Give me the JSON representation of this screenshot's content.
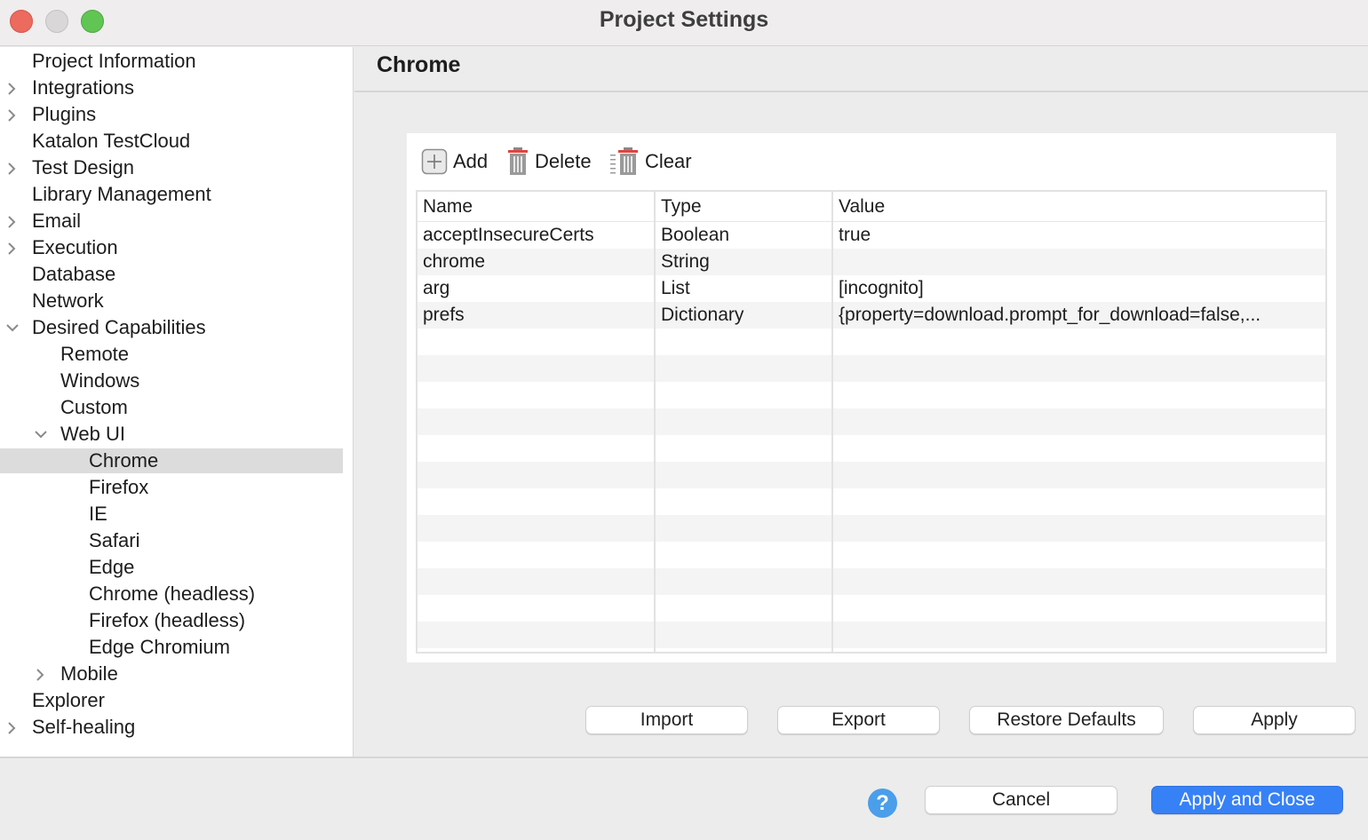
{
  "window": {
    "title": "Project Settings"
  },
  "sidebar": {
    "items": [
      {
        "label": "Project Information",
        "level": 0,
        "expander": "none",
        "selected": false
      },
      {
        "label": "Integrations",
        "level": 0,
        "expander": "collapsed",
        "selected": false
      },
      {
        "label": "Plugins",
        "level": 0,
        "expander": "collapsed",
        "selected": false
      },
      {
        "label": "Katalon TestCloud",
        "level": 0,
        "expander": "none",
        "selected": false
      },
      {
        "label": "Test Design",
        "level": 0,
        "expander": "collapsed",
        "selected": false
      },
      {
        "label": "Library Management",
        "level": 0,
        "expander": "none",
        "selected": false
      },
      {
        "label": "Email",
        "level": 0,
        "expander": "collapsed",
        "selected": false
      },
      {
        "label": "Execution",
        "level": 0,
        "expander": "collapsed",
        "selected": false
      },
      {
        "label": "Database",
        "level": 0,
        "expander": "none",
        "selected": false
      },
      {
        "label": "Network",
        "level": 0,
        "expander": "none",
        "selected": false
      },
      {
        "label": "Desired Capabilities",
        "level": 0,
        "expander": "expanded",
        "selected": false
      },
      {
        "label": "Remote",
        "level": 1,
        "expander": "none",
        "selected": false
      },
      {
        "label": "Windows",
        "level": 1,
        "expander": "none",
        "selected": false
      },
      {
        "label": "Custom",
        "level": 1,
        "expander": "none",
        "selected": false
      },
      {
        "label": "Web UI",
        "level": 1,
        "expander": "expanded",
        "selected": false
      },
      {
        "label": "Chrome",
        "level": 2,
        "expander": "none",
        "selected": true
      },
      {
        "label": "Firefox",
        "level": 2,
        "expander": "none",
        "selected": false
      },
      {
        "label": "IE",
        "level": 2,
        "expander": "none",
        "selected": false
      },
      {
        "label": "Safari",
        "level": 2,
        "expander": "none",
        "selected": false
      },
      {
        "label": "Edge",
        "level": 2,
        "expander": "none",
        "selected": false
      },
      {
        "label": "Chrome (headless)",
        "level": 2,
        "expander": "none",
        "selected": false
      },
      {
        "label": "Firefox (headless)",
        "level": 2,
        "expander": "none",
        "selected": false
      },
      {
        "label": "Edge Chromium",
        "level": 2,
        "expander": "none",
        "selected": false
      },
      {
        "label": "Mobile",
        "level": 1,
        "expander": "collapsed",
        "selected": false
      },
      {
        "label": "Explorer",
        "level": 0,
        "expander": "none",
        "selected": false
      },
      {
        "label": "Self-healing",
        "level": 0,
        "expander": "collapsed",
        "selected": false
      }
    ]
  },
  "main": {
    "title": "Chrome",
    "toolbar": {
      "add_label": "Add",
      "delete_label": "Delete",
      "clear_label": "Clear"
    },
    "table": {
      "columns": [
        "Name",
        "Type",
        "Value"
      ],
      "rows": [
        {
          "name": "acceptInsecureCerts",
          "type": "Boolean",
          "value": "true"
        },
        {
          "name": "chrome",
          "type": "String",
          "value": ""
        },
        {
          "name": "arg",
          "type": "List",
          "value": "[incognito]"
        },
        {
          "name": "prefs",
          "type": "Dictionary",
          "value": "{property=download.prompt_for_download=false,..."
        }
      ]
    },
    "buttons": {
      "import": "Import",
      "export": "Export",
      "restore_defaults": "Restore Defaults",
      "apply": "Apply"
    }
  },
  "footer": {
    "help_glyph": "?",
    "cancel": "Cancel",
    "apply_and_close": "Apply and Close"
  },
  "colors": {
    "accent": "#3781f6",
    "selection": "#dcdcdc",
    "help": "#4a9eea"
  }
}
